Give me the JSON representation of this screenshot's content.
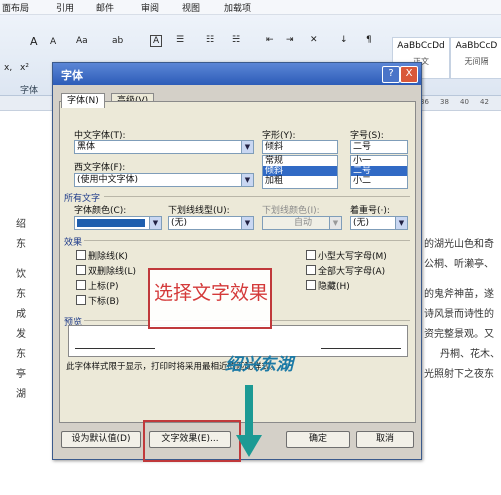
{
  "menubar": {
    "items": [
      "面布局",
      "引用",
      "邮件",
      "审阅",
      "视图",
      "加载项"
    ]
  },
  "ribbon": {
    "font_group_label": "字体",
    "styles": [
      "AaBbCcDd",
      "AaBbCcD"
    ],
    "style_names": [
      "正文",
      "无间隔"
    ],
    "font_tools": [
      "A",
      "A",
      "Aa",
      "ab",
      "A"
    ]
  },
  "ruler": {
    "marks": [
      "36",
      "38",
      "40",
      "42"
    ]
  },
  "document": {
    "left_chars": [
      "绍",
      "东",
      "饮",
      "东",
      "成",
      "发",
      "东",
      "亭",
      "湖"
    ],
    "right_lines": [
      "的湖光山色和奇",
      "公桐、听濑亭、",
      "的鬼斧神苗，遂",
      "诗风景而诗性的",
      "资完整景观。又",
      "丹桐、花木、",
      "光照射下之夜东"
    ]
  },
  "dialog": {
    "title": "字体",
    "help": "?",
    "close": "X",
    "tabs": [
      "字体(N)",
      "高级(V)"
    ],
    "labels": {
      "chinese_font": "中文字体(T):",
      "style": "字形(Y):",
      "size": "字号(S):",
      "western_font": "西文字体(F):",
      "all_text": "所有文字",
      "font_color": "字体颜色(C):",
      "underline": "下划线线型(U):",
      "underline_color": "下划线颜色(I):",
      "emphasis": "着重号(·):",
      "effects": "效果",
      "preview": "预览"
    },
    "values": {
      "chinese_font": "黑体",
      "style": "倾斜",
      "size": "二号",
      "western_font": "(使用中文字体)",
      "underline": "(无)",
      "underline_color": "自动",
      "emphasis": "(无)"
    },
    "style_list": [
      "常规",
      "倾斜",
      "加粗"
    ],
    "size_list": [
      "小一",
      "二号",
      "小二"
    ],
    "effects_left": [
      "删除线(K)",
      "双删除线(L)",
      "上标(P)",
      "下标(B)"
    ],
    "effects_right": [
      "小型大写字母(M)",
      "全部大写字母(A)",
      "隐藏(H)"
    ],
    "preview_sample": "绍兴东湖",
    "note": "此字体样式限于显示，打印时将采用最相近的匹配样式。",
    "buttons": {
      "default": "设为默认值(D)",
      "text_effects": "文字效果(E)...",
      "ok": "确定",
      "cancel": "取消"
    },
    "callout": "选择文字效果"
  },
  "colors": {
    "callout": "#d43a3a",
    "arrow": "#1c9a94",
    "sample": "#1c7aa6"
  }
}
